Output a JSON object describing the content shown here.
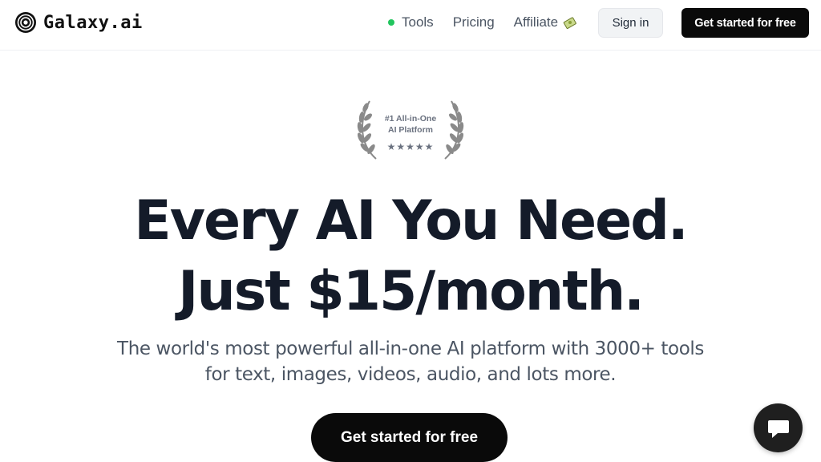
{
  "header": {
    "logo_text": "Galaxy.ai",
    "logo_icon": "galaxy-spiral-icon",
    "nav": [
      {
        "label": "Tools",
        "status_dot_color": "#22c55e"
      },
      {
        "label": "Pricing"
      },
      {
        "label": "Affiliate",
        "icon": "money-icon"
      }
    ],
    "signin_label": "Sign in",
    "get_started_label": "Get started for free"
  },
  "award": {
    "line1": "#1 All-in-One",
    "line2": "AI Platform",
    "stars": "★★★★★",
    "icon": "laurel-wreath-icon"
  },
  "hero": {
    "title_line1": "Every AI You Need.",
    "title_line2": "Just $15/month.",
    "subtitle_line1": "The world's most powerful all-in-one AI platform with 3000+ tools",
    "subtitle_line2": "for text, images, videos, audio, and lots more.",
    "cta_label": "Get started for free"
  },
  "chat": {
    "icon": "chat-bubble-icon"
  },
  "colors": {
    "accent": "#0a0a0a",
    "text": "#141b29",
    "muted": "#4b5563",
    "status_green": "#22c55e"
  }
}
